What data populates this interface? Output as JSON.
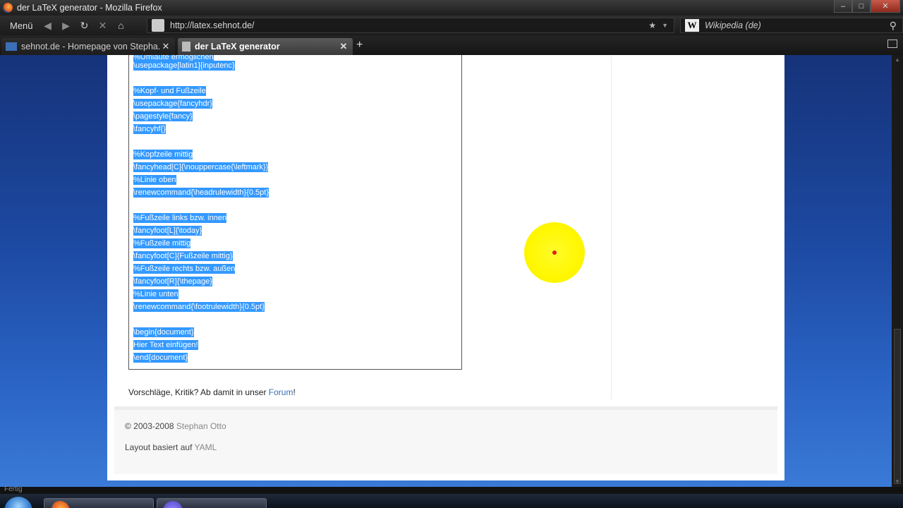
{
  "window": {
    "title": "der LaTeX generator - Mozilla Firefox",
    "minimize": "–",
    "maximize": "□",
    "close": "✕"
  },
  "nav": {
    "menu_label": "Menü",
    "back_glyph": "◀",
    "forward_glyph": "▶",
    "reload_glyph": "↻",
    "stop_glyph": "✕",
    "home_glyph": "⌂",
    "url": "http://latex.sehnot.de/",
    "star_glyph": "★",
    "dropdown_glyph": "▼",
    "search_engine": "Wikipedia (de)",
    "search_glyph": "⚲",
    "wiki_letter": "W"
  },
  "tabs": [
    {
      "label": "sehnot.de - Homepage von Stepha...",
      "close": "✕"
    },
    {
      "label": "der LaTeX generator",
      "close": "✕"
    }
  ],
  "new_tab": "+",
  "code_lines": [
    "%Umlaute ermöglichen",
    "\\usepackage[latin1]{inputenc}",
    "%Kopf- und Fußzeile",
    "\\usepackage{fancyhdr}",
    "\\pagestyle{fancy}",
    "\\fancyhf{}",
    "%Kopfzeile mittig",
    "\\fancyhead[C]{\\nouppercase{\\leftmark}}",
    "%Linie oben",
    "\\renewcommand{\\headrulewidth}{0.5pt}",
    "%Fußzeile links bzw. innen",
    "\\fancyfoot[L]{\\today}",
    "%Fußzeile mittig",
    "\\fancyfoot[C]{Fußzeile mittig}",
    "%Fußzeile rechts bzw. außen",
    "\\fancyfoot[R]{\\thepage}",
    "%Linie unten",
    "\\renewcommand{\\footrulewidth}{0.5pt}",
    "\\begin{document}",
    "Hier Text einfügen!",
    "\\end{document}"
  ],
  "feedback": {
    "prefix": "Vorschläge, Kritik? Ab damit in unser ",
    "link": "Forum",
    "suffix": "!"
  },
  "footer": {
    "copyright_prefix": "© 2003-2008 ",
    "author": "Stephan Otto",
    "layout_prefix": "Layout basiert auf ",
    "layout_link": "YAML"
  },
  "status": "Fertig",
  "colors": {
    "selection": "#3399ff",
    "link": "#3a6fb0",
    "cursor_highlight": "#fff700"
  }
}
